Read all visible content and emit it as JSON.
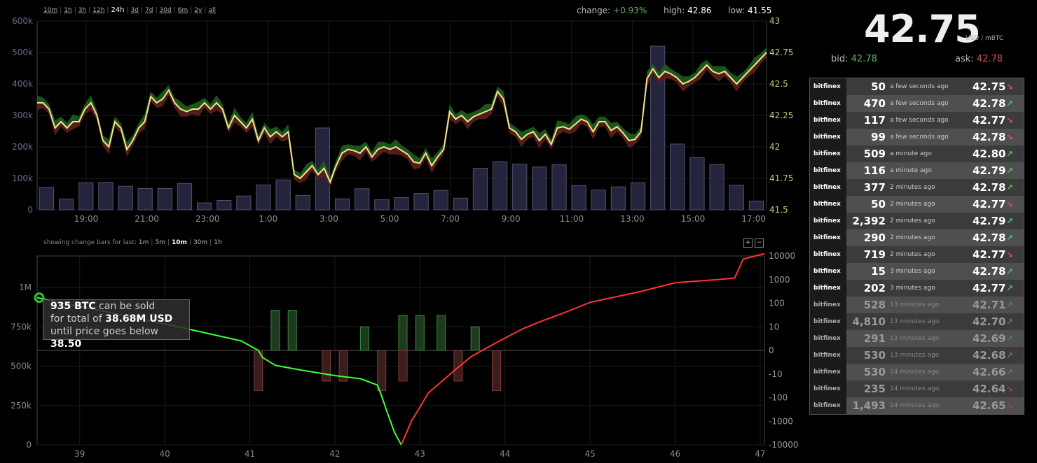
{
  "ranges": [
    "10m",
    "1h",
    "3h",
    "12h",
    "24h",
    "3d",
    "7d",
    "30d",
    "6m",
    "2y",
    "all"
  ],
  "active_range": "24h",
  "stats": {
    "change_label": "change:",
    "change": "+0.93%",
    "high_label": "high:",
    "high": "42.86",
    "low_label": "low:",
    "low": "41.55"
  },
  "ticker": {
    "price": "42.75",
    "unit": "USD / mBTC",
    "bid_label": "bid:",
    "bid": "42.78",
    "ask_label": "ask:",
    "ask": "42.78"
  },
  "depth_controls": {
    "label": "showing change bars for last:",
    "options": [
      "1m",
      "5m",
      "10m",
      "30m",
      "1h"
    ],
    "active": "10m",
    "zoom_in": "+",
    "zoom_out": "−"
  },
  "tooltip": {
    "btc": "935 BTC",
    "line1_suffix": " can be sold",
    "line2_prefix": "for total of ",
    "usd": "38.68M USD",
    "line3_prefix": "until price goes below ",
    "price": "38.50"
  },
  "colors": {
    "up": "#5cb85c",
    "down": "#d9534f",
    "price_line": "#f0e68c",
    "volume": "#2c2c48",
    "bid_line": "#4cff4c",
    "ask_line": "#ff3333"
  },
  "trades": [
    {
      "exchange": "bitfinex",
      "amount": "50",
      "ago": "a few seconds ago",
      "price": "42.75",
      "dir": "down"
    },
    {
      "exchange": "bitfinex",
      "amount": "470",
      "ago": "a few seconds ago",
      "price": "42.78",
      "dir": "up"
    },
    {
      "exchange": "bitfinex",
      "amount": "117",
      "ago": "a few seconds ago",
      "price": "42.77",
      "dir": "down"
    },
    {
      "exchange": "bitfinex",
      "amount": "99",
      "ago": "a few seconds ago",
      "price": "42.78",
      "dir": "down"
    },
    {
      "exchange": "bitfinex",
      "amount": "509",
      "ago": "a minute ago",
      "price": "42.80",
      "dir": "up"
    },
    {
      "exchange": "bitfinex",
      "amount": "116",
      "ago": "a minute ago",
      "price": "42.79",
      "dir": "up"
    },
    {
      "exchange": "bitfinex",
      "amount": "377",
      "ago": "2 minutes ago",
      "price": "42.78",
      "dir": "up"
    },
    {
      "exchange": "bitfinex",
      "amount": "50",
      "ago": "2 minutes ago",
      "price": "42.77",
      "dir": "down"
    },
    {
      "exchange": "bitfinex",
      "amount": "2,392",
      "ago": "2 minutes ago",
      "price": "42.79",
      "dir": "up"
    },
    {
      "exchange": "bitfinex",
      "amount": "290",
      "ago": "2 minutes ago",
      "price": "42.78",
      "dir": "up"
    },
    {
      "exchange": "bitfinex",
      "amount": "719",
      "ago": "2 minutes ago",
      "price": "42.77",
      "dir": "down"
    },
    {
      "exchange": "bitfinex",
      "amount": "15",
      "ago": "3 minutes ago",
      "price": "42.78",
      "dir": "up"
    },
    {
      "exchange": "bitfinex",
      "amount": "202",
      "ago": "3 minutes ago",
      "price": "42.77",
      "dir": "up"
    },
    {
      "exchange": "bitfinex",
      "amount": "528",
      "ago": "13 minutes ago",
      "price": "42.71",
      "dir": "up"
    },
    {
      "exchange": "bitfinex",
      "amount": "4,810",
      "ago": "13 minutes ago",
      "price": "42.70",
      "dir": "up"
    },
    {
      "exchange": "bitfinex",
      "amount": "291",
      "ago": "13 minutes ago",
      "price": "42.69",
      "dir": "up"
    },
    {
      "exchange": "bitfinex",
      "amount": "530",
      "ago": "13 minutes ago",
      "price": "42.68",
      "dir": "up"
    },
    {
      "exchange": "bitfinex",
      "amount": "530",
      "ago": "14 minutes ago",
      "price": "42.66",
      "dir": "up"
    },
    {
      "exchange": "bitfinex",
      "amount": "235",
      "ago": "14 minutes ago",
      "price": "42.64",
      "dir": "down"
    },
    {
      "exchange": "bitfinex",
      "amount": "1,493",
      "ago": "14 minutes ago",
      "price": "42.65",
      "dir": "down"
    }
  ],
  "chart_data": [
    {
      "type": "line",
      "x_tick_labels": [
        "19:00",
        "21:00",
        "23:00",
        "1:00",
        "3:00",
        "5:00",
        "7:00",
        "9:00",
        "11:00",
        "13:00",
        "15:00",
        "17:00"
      ],
      "y_left_ticks": [
        "0",
        "100k",
        "200k",
        "300k",
        "400k",
        "500k",
        "600k"
      ],
      "y_left_lim": [
        0,
        600000
      ],
      "y_right_ticks": [
        "41.5",
        "41.75",
        "42",
        "42.25",
        "42.5",
        "42.75",
        "43"
      ],
      "y_right_lim": [
        41.5,
        43
      ],
      "price": [
        42.35,
        42.35,
        42.3,
        42.15,
        42.2,
        42.15,
        42.2,
        42.2,
        42.3,
        42.35,
        42.25,
        42.05,
        42.0,
        42.2,
        42.15,
        41.98,
        42.05,
        42.15,
        42.2,
        42.4,
        42.35,
        42.38,
        42.45,
        42.35,
        42.3,
        42.28,
        42.3,
        42.3,
        42.35,
        42.3,
        42.35,
        42.3,
        42.15,
        42.25,
        42.2,
        42.15,
        42.22,
        42.05,
        42.15,
        42.08,
        42.12,
        42.08,
        42.12,
        41.78,
        41.75,
        41.8,
        41.85,
        41.78,
        41.83,
        41.72,
        41.85,
        41.95,
        41.98,
        41.97,
        41.95,
        42.0,
        41.92,
        41.98,
        42.0,
        41.98,
        42.0,
        41.97,
        41.94,
        41.88,
        41.87,
        41.95,
        41.85,
        41.92,
        41.98,
        42.28,
        42.22,
        42.25,
        42.2,
        42.24,
        42.26,
        42.28,
        42.3,
        42.44,
        42.38,
        42.15,
        42.12,
        42.06,
        42.1,
        42.12,
        42.05,
        42.1,
        42.02,
        42.15,
        42.16,
        42.14,
        42.18,
        42.22,
        42.2,
        42.12,
        42.2,
        42.2,
        42.13,
        42.16,
        42.11,
        42.05,
        42.06,
        42.12,
        42.54,
        42.62,
        42.55,
        42.6,
        42.58,
        42.55,
        42.5,
        42.52,
        42.55,
        42.6,
        42.65,
        42.6,
        42.58,
        42.6,
        42.55,
        42.5,
        42.55,
        42.6,
        42.65,
        42.7,
        42.75
      ],
      "volume": [
        71000,
        34000,
        86000,
        87000,
        75000,
        68000,
        68000,
        84000,
        22000,
        30000,
        44000,
        79000,
        95000,
        46000,
        260000,
        35000,
        67000,
        32000,
        39000,
        52000,
        62000,
        37000,
        132000,
        153000,
        145000,
        136000,
        143000,
        77000,
        63000,
        73000,
        86000,
        520000,
        209000,
        166000,
        144000,
        78000,
        28000
      ]
    },
    {
      "type": "area",
      "x_ticks": [
        39,
        40,
        41,
        42,
        43,
        44,
        45,
        46,
        47
      ],
      "x_lim": [
        38.5,
        47.05
      ],
      "y_left_ticks": [
        "0",
        "250k",
        "500k",
        "750k",
        "1M"
      ],
      "y_left_lim": [
        0,
        1200000
      ],
      "y_right_ticks": [
        "10000",
        "1000",
        "100",
        "10",
        "0",
        "-10",
        "-100",
        "-1000",
        "-10000"
      ],
      "bids": [
        [
          38.5,
          935000
        ],
        [
          39.5,
          825000
        ],
        [
          40.2,
          745000
        ],
        [
          40.9,
          660000
        ],
        [
          41.1,
          600000
        ],
        [
          41.15,
          555000
        ],
        [
          41.3,
          505000
        ],
        [
          41.6,
          475000
        ],
        [
          42.0,
          440000
        ],
        [
          42.3,
          420000
        ],
        [
          42.5,
          380000
        ],
        [
          42.55,
          310000
        ],
        [
          42.6,
          230000
        ],
        [
          42.7,
          80000
        ],
        [
          42.78,
          0
        ]
      ],
      "asks": [
        [
          42.78,
          0
        ],
        [
          42.9,
          150000
        ],
        [
          43.1,
          330000
        ],
        [
          43.4,
          470000
        ],
        [
          43.6,
          560000
        ],
        [
          43.9,
          650000
        ],
        [
          44.2,
          735000
        ],
        [
          44.4,
          780000
        ],
        [
          44.7,
          840000
        ],
        [
          45.0,
          905000
        ],
        [
          45.6,
          975000
        ],
        [
          46.0,
          1030000
        ],
        [
          46.5,
          1050000
        ],
        [
          46.7,
          1060000
        ],
        [
          46.8,
          1180000
        ],
        [
          47.05,
          1215000
        ]
      ],
      "change_bars": [
        [
          41.1,
          -50
        ],
        [
          41.3,
          50
        ],
        [
          41.5,
          50
        ],
        [
          41.9,
          -20
        ],
        [
          42.1,
          -20
        ],
        [
          42.35,
          10
        ],
        [
          42.55,
          -50
        ],
        [
          42.8,
          30
        ],
        [
          42.8,
          -20
        ],
        [
          43.0,
          30
        ],
        [
          43.25,
          30
        ],
        [
          43.45,
          -20
        ],
        [
          43.65,
          10
        ],
        [
          43.9,
          -50
        ]
      ]
    }
  ]
}
